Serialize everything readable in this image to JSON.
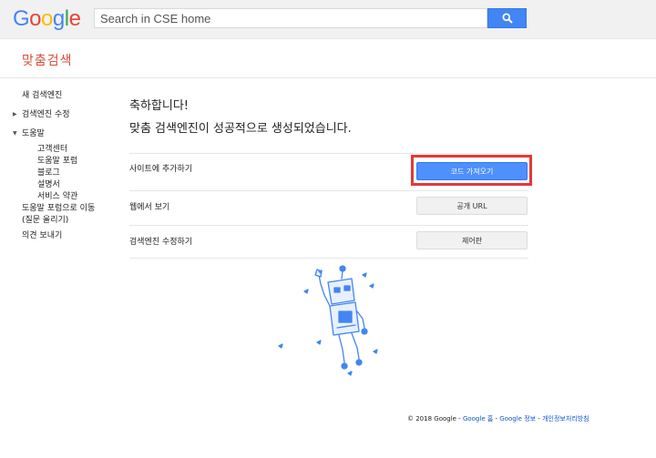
{
  "logo": {
    "letters": [
      "G",
      "o",
      "o",
      "g",
      "l",
      "e"
    ],
    "colors": [
      "#4285f4",
      "#ea4335",
      "#fbbc05",
      "#4285f4",
      "#34a853",
      "#ea4335"
    ]
  },
  "search": {
    "placeholder": "Search in CSE home",
    "button_icon": "search-icon"
  },
  "product_title": "맞춤검색",
  "sidebar": {
    "new_engine": "새 검색엔진",
    "edit_engine": "검색엔진 수정",
    "help": "도움말",
    "help_items": [
      "고객센터",
      "도움말 포럼",
      "블로그",
      "설명서",
      "서비스 약관"
    ],
    "forum_line1": "도움말 포럼으로 이동",
    "forum_line2": "(질문 올리기)",
    "feedback": "의견 보내기"
  },
  "main": {
    "congrats": "축하합니다!",
    "success": "맞춤 검색엔진이 성공적으로 생성되었습니다.",
    "rows": [
      {
        "label": "사이트에 추가하기",
        "button": "코드 가져오기"
      },
      {
        "label": "웹에서 보기",
        "button": "공개 URL"
      },
      {
        "label": "검색엔진 수정하기",
        "button": "제어판"
      }
    ]
  },
  "footer": {
    "copyright": "© 2018 Google",
    "sep": " - ",
    "links": [
      "Google 홈",
      "Google 정보",
      "개인정보처리방침"
    ]
  },
  "colors": {
    "accent": "#4285f4",
    "title": "#dd4b39",
    "highlight": "#e53935",
    "link": "#1155cc"
  }
}
